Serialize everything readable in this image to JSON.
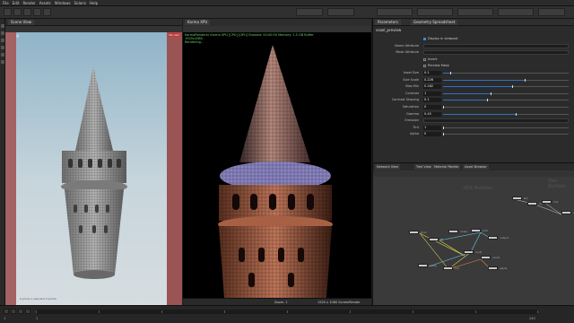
{
  "menubar": {
    "items": [
      "File",
      "Edit",
      "Render",
      "Assets",
      "Windows",
      "Solaris",
      "Help"
    ]
  },
  "viewport_left": {
    "tab": "Scene View",
    "persp_label": "Persp",
    "cam_label": "No cam",
    "status": "0 prims  1 selected  0 points"
  },
  "viewport_right": {
    "tab": "Karma XPU",
    "hud_lines": [
      "KarmaRenderer  Karma XPU  [CPU] [GPU]  Elapsed: 00:00:00   Memory: 1.5 GB   Buffer",
      "1920x1080",
      "Rendering..."
    ],
    "zoom": "Zoom: 1",
    "coords": "1920 x 1080   ScreenRender  "
  },
  "params": {
    "tabs": [
      "Parameters",
      "Geometry Spreadsheet"
    ],
    "node_title": "voxel_preview",
    "rows": [
      {
        "label": "",
        "type": "check",
        "checked": true,
        "text": "Display in viewport"
      },
      {
        "label": "Name Attribute",
        "type": "field"
      },
      {
        "label": "Mask Attribute",
        "type": "field"
      },
      {
        "label": "",
        "type": "check",
        "checked": false,
        "text": "Invert"
      },
      {
        "label": "",
        "type": "check",
        "checked": false,
        "text": "Preview Mask"
      },
      {
        "label": "Voxel Size",
        "type": "slider",
        "value": "0.1",
        "level": 0.06
      },
      {
        "label": "Size Scale",
        "type": "slider",
        "value": "0.226",
        "level": 0.65
      },
      {
        "label": "Bias Min",
        "type": "slider",
        "value": "0.162",
        "level": 0.55
      },
      {
        "label": "Contrast",
        "type": "slider",
        "value": "1",
        "level": 0.38
      },
      {
        "label": "Contrast Shaping",
        "type": "slider",
        "value": "0.1",
        "level": 0.35
      },
      {
        "label": "Saturation",
        "type": "slider",
        "value": "0",
        "level": 0.0
      },
      {
        "label": "Gamma",
        "type": "slider",
        "value": "0.45",
        "level": 0.58
      },
      {
        "label": "Emission",
        "type": "field"
      },
      {
        "label": "Tint",
        "type": "slider",
        "value": "1",
        "level": 0.0
      },
      {
        "label": "Alpha",
        "type": "slider",
        "value": "0",
        "level": 0.0
      }
    ],
    "slider_color": "#2e72c4"
  },
  "network": {
    "tabs": [
      "Network View",
      "Tree View",
      "Material Palette",
      "Asset Browser"
    ],
    "context": "VEX Builder",
    "context2": "Vex Builder",
    "nodes": [
      {
        "name": "tex"
      },
      {
        "name": "uv"
      },
      {
        "name": "mix"
      },
      {
        "name": "color"
      },
      {
        "name": "bind"
      },
      {
        "name": "fit"
      },
      {
        "name": "noise"
      },
      {
        "name": "add"
      },
      {
        "name": "mult"
      },
      {
        "name": "output"
      },
      {
        "name": "const"
      },
      {
        "name": "ramp"
      },
      {
        "name": "out"
      },
      {
        "name": "alpha"
      }
    ]
  },
  "timeline": {
    "frame": "1",
    "start": "1",
    "end": "240"
  }
}
